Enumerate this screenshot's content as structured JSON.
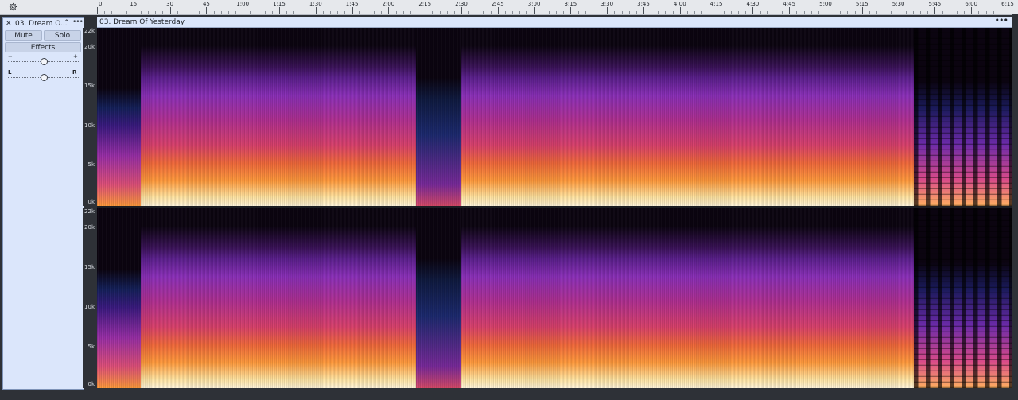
{
  "app": {
    "settings_icon": "gear-icon"
  },
  "timeline": {
    "ticks": [
      "0",
      "15",
      "30",
      "45",
      "1:00",
      "1:15",
      "1:30",
      "1:45",
      "2:00",
      "2:15",
      "2:30",
      "2:45",
      "3:00",
      "3:15",
      "3:30",
      "3:45",
      "4:00",
      "4:15",
      "4:30",
      "4:45",
      "5:00",
      "5:15",
      "5:30",
      "5:45",
      "6:00",
      "6:15"
    ]
  },
  "track": {
    "name": "03. Dream O...",
    "close_icon": "close-icon",
    "collapse_icon": "chevron-up-icon",
    "menu_icon": "more-horizontal-icon",
    "mute_label": "Mute",
    "solo_label": "Solo",
    "effects_label": "Effects",
    "gain": {
      "minus_label": "−",
      "plus_label": "+",
      "value": 0.5
    },
    "pan": {
      "left_label": "L",
      "right_label": "R",
      "value": 0.5
    }
  },
  "clip": {
    "title": "03. Dream Of Yesterday",
    "menu_icon": "more-horizontal-icon",
    "view": "spectrogram",
    "channels": 2
  },
  "frequency_axis": {
    "labels": [
      "22k",
      "20k",
      "15k",
      "10k",
      "5k",
      "0k"
    ]
  },
  "colors": {
    "panel_bg": "#dbe6fb",
    "app_bg": "#2e3137",
    "spectrum_low": "#0b0410",
    "spectrum_mid": "#8a2fb8",
    "spectrum_high": "#ff9a3c",
    "spectrum_peak": "#fff4d8"
  }
}
